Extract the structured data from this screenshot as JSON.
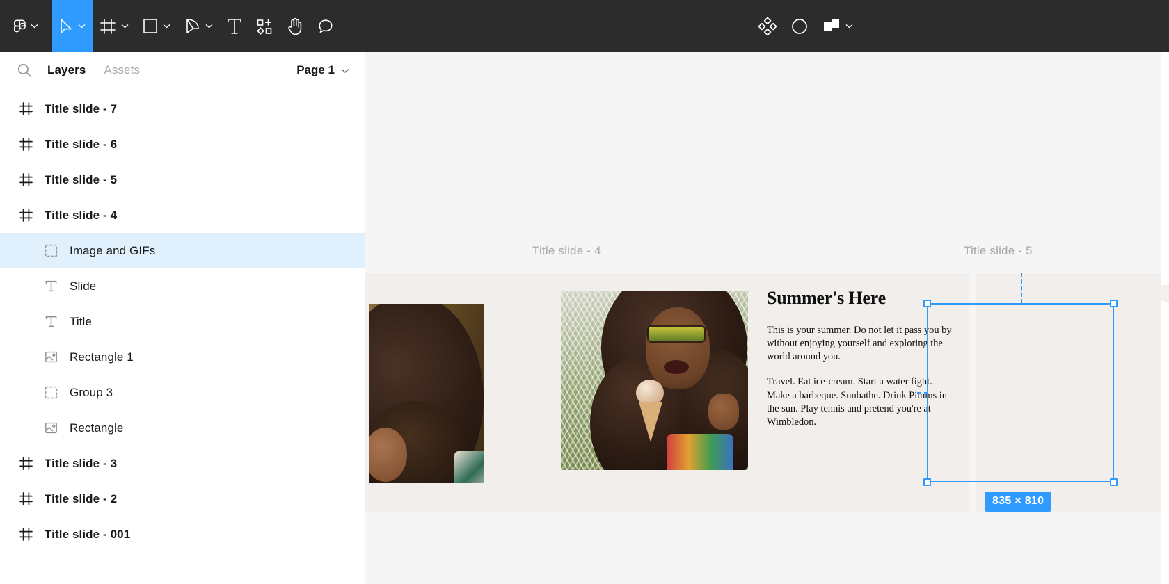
{
  "toolbar": {
    "left_tools": [
      {
        "name": "figma-logo-icon",
        "label": "Figma",
        "has_caret": true,
        "active": false
      },
      {
        "name": "move-tool",
        "label": "Move",
        "has_caret": true,
        "active": true
      },
      {
        "name": "frame-tool",
        "label": "Frame",
        "has_caret": true,
        "active": false
      },
      {
        "name": "shape-tool",
        "label": "Rectangle",
        "has_caret": true,
        "active": false
      },
      {
        "name": "pen-tool",
        "label": "Pen",
        "has_caret": true,
        "active": false
      },
      {
        "name": "text-tool",
        "label": "Text",
        "has_caret": false,
        "active": false
      },
      {
        "name": "resources-tool",
        "label": "Resources",
        "has_caret": false,
        "active": false
      },
      {
        "name": "hand-tool",
        "label": "Hand",
        "has_caret": false,
        "active": false
      },
      {
        "name": "comment-tool",
        "label": "Comment",
        "has_caret": false,
        "active": false
      }
    ],
    "right_tools": [
      {
        "name": "components-icon",
        "label": "Components",
        "has_caret": false
      },
      {
        "name": "mask-icon",
        "label": "Mask",
        "has_caret": false
      },
      {
        "name": "boolean-icon",
        "label": "Boolean groups",
        "has_caret": true
      }
    ],
    "accent_color": "#2f9bff",
    "background_color": "#2c2c2c"
  },
  "left_panel": {
    "search_icon": "search-icon",
    "tabs": [
      {
        "label": "Layers",
        "active": true
      },
      {
        "label": "Assets",
        "active": false
      }
    ],
    "page_selector": {
      "label": "Page 1",
      "caret": "chevron-down-icon"
    },
    "layers": [
      {
        "label": "Title slide - 7",
        "icon": "frame-icon",
        "depth": 0,
        "selected": false
      },
      {
        "label": "Title slide - 6",
        "icon": "frame-icon",
        "depth": 0,
        "selected": false
      },
      {
        "label": "Title slide - 5",
        "icon": "frame-icon",
        "depth": 0,
        "selected": false
      },
      {
        "label": "Title slide - 4",
        "icon": "frame-icon",
        "depth": 0,
        "selected": false
      },
      {
        "label": "Image and GIFs",
        "icon": "group-icon",
        "depth": 1,
        "selected": true
      },
      {
        "label": "Slide",
        "icon": "text-icon",
        "depth": 1,
        "selected": false
      },
      {
        "label": "Title",
        "icon": "text-icon",
        "depth": 1,
        "selected": false
      },
      {
        "label": "Rectangle 1",
        "icon": "image-icon",
        "depth": 1,
        "selected": false
      },
      {
        "label": "Group 3",
        "icon": "group-icon",
        "depth": 1,
        "selected": false
      },
      {
        "label": "Rectangle",
        "icon": "image-icon",
        "depth": 1,
        "selected": false
      },
      {
        "label": "Title slide - 3",
        "icon": "frame-icon",
        "depth": 0,
        "selected": false
      },
      {
        "label": "Title slide - 2",
        "icon": "frame-icon",
        "depth": 0,
        "selected": false
      },
      {
        "label": "Title slide - 001",
        "icon": "frame-icon",
        "depth": 0,
        "selected": false
      }
    ],
    "selected_row_color": "#e0f0fc"
  },
  "canvas": {
    "background_color": "#f5f5f5",
    "frames": [
      {
        "label": "Title slide - 3",
        "label_visible": false
      },
      {
        "label": "Title slide - 4",
        "label_visible": true
      },
      {
        "label": "Title slide - 5",
        "label_visible": true
      }
    ],
    "main_frame_label": "Title slide - 4",
    "right_frame_label": "Title slide - 5",
    "slide": {
      "title": "Summer's Here",
      "paragraph_1": "This is your summer. Do not let it pass you by without enjoying yourself and exploring the world around you.",
      "paragraph_2": "Travel. Eat ice-cream. Start a water fight. Make a barbeque. Sunbathe. Drink Pimms in the sun. Play tennis and pretend you're at Wimbledon.",
      "background_color": "#f2eeec"
    },
    "selection": {
      "size_badge": "835 × 810",
      "width": "835",
      "height": "810",
      "color": "#2f9bff",
      "handles": [
        "top-left",
        "top-right",
        "bottom-left",
        "bottom-right"
      ]
    }
  }
}
